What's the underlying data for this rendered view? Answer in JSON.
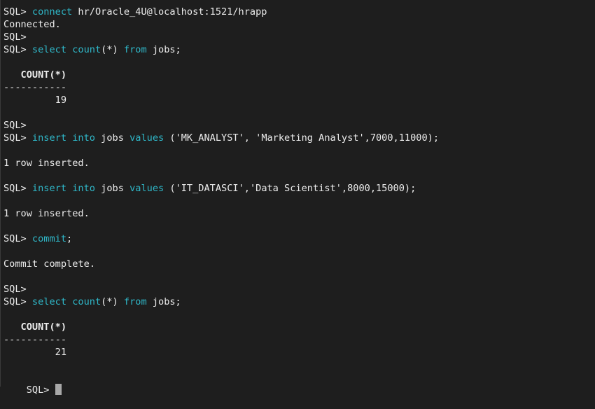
{
  "terminal": {
    "prompt": "SQL>",
    "lines": [
      {
        "parts": [
          {
            "t": "SQL> ",
            "k": 0
          },
          {
            "t": "connect",
            "k": 1
          },
          {
            "t": " hr/Oracle_4U@localhost:1521/hrapp",
            "k": 0
          }
        ]
      },
      {
        "parts": [
          {
            "t": "Connected.",
            "k": 0
          }
        ]
      },
      {
        "parts": [
          {
            "t": "SQL>",
            "k": 0
          }
        ]
      },
      {
        "parts": [
          {
            "t": "SQL> ",
            "k": 0
          },
          {
            "t": "select",
            "k": 1
          },
          {
            "t": " ",
            "k": 0
          },
          {
            "t": "count",
            "k": 1
          },
          {
            "t": "(*) ",
            "k": 0
          },
          {
            "t": "from",
            "k": 1
          },
          {
            "t": " jobs;",
            "k": 0
          }
        ]
      },
      {
        "parts": [
          {
            "t": "   COUNT(*)",
            "k": 2
          }
        ]
      },
      {
        "parts": [
          {
            "t": "-----------",
            "k": 0
          }
        ]
      },
      {
        "parts": [
          {
            "t": "         19",
            "k": 0
          }
        ]
      },
      {
        "parts": [
          {
            "t": "SQL>",
            "k": 0
          }
        ]
      },
      {
        "parts": [
          {
            "t": "SQL> ",
            "k": 0
          },
          {
            "t": "insert",
            "k": 1
          },
          {
            "t": " ",
            "k": 0
          },
          {
            "t": "into",
            "k": 1
          },
          {
            "t": " jobs ",
            "k": 0
          },
          {
            "t": "values",
            "k": 1
          },
          {
            "t": " ('MK_ANALYST', 'Marketing Analyst',7000,11000);",
            "k": 0
          }
        ]
      },
      {
        "parts": [
          {
            "t": "1 row inserted.",
            "k": 0
          }
        ]
      },
      {
        "parts": [
          {
            "t": "SQL> ",
            "k": 0
          },
          {
            "t": "insert",
            "k": 1
          },
          {
            "t": " ",
            "k": 0
          },
          {
            "t": "into",
            "k": 1
          },
          {
            "t": " jobs ",
            "k": 0
          },
          {
            "t": "values",
            "k": 1
          },
          {
            "t": " ('IT_DATASCI','Data Scientist',8000,15000);",
            "k": 0
          }
        ]
      },
      {
        "parts": [
          {
            "t": "1 row inserted.",
            "k": 0
          }
        ]
      },
      {
        "parts": [
          {
            "t": "SQL> ",
            "k": 0
          },
          {
            "t": "commit",
            "k": 1
          },
          {
            "t": ";",
            "k": 0
          }
        ]
      },
      {
        "parts": [
          {
            "t": "Commit complete.",
            "k": 0
          }
        ]
      },
      {
        "parts": [
          {
            "t": "SQL>",
            "k": 0
          }
        ]
      },
      {
        "parts": [
          {
            "t": "SQL> ",
            "k": 0
          },
          {
            "t": "select",
            "k": 1
          },
          {
            "t": " ",
            "k": 0
          },
          {
            "t": "count",
            "k": 1
          },
          {
            "t": "(*) ",
            "k": 0
          },
          {
            "t": "from",
            "k": 1
          },
          {
            "t": " jobs;",
            "k": 0
          }
        ]
      },
      {
        "parts": [
          {
            "t": "   COUNT(*)",
            "k": 2
          }
        ]
      },
      {
        "parts": [
          {
            "t": "-----------",
            "k": 0
          }
        ]
      },
      {
        "parts": [
          {
            "t": "         21",
            "k": 0
          }
        ]
      }
    ],
    "current_prompt": "SQL> "
  },
  "colors": {
    "background": "#1e1e1e",
    "text": "#ececec",
    "keyword": "#2fb8c9",
    "cursor": "#a8a8a8"
  }
}
